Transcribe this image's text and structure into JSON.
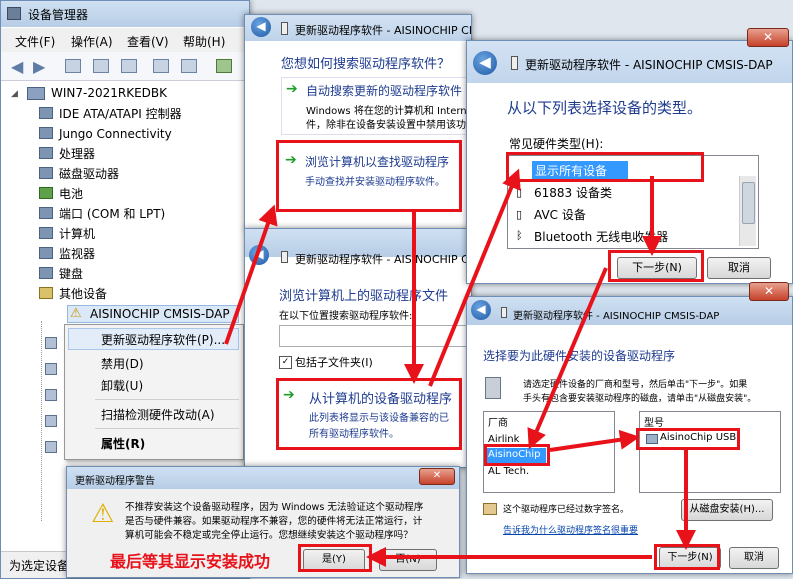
{
  "devmgr": {
    "title": "设备管理器",
    "menu": [
      "文件(F)",
      "操作(A)",
      "查看(V)",
      "帮助(H)"
    ],
    "computer": "WIN7-2021RKEDBK",
    "tree": [
      "IDE ATA/ATAPI 控制器",
      "Jungo Connectivity",
      "处理器",
      "磁盘驱动器",
      "电池",
      "端口 (COM 和 LPT)",
      "计算机",
      "监视器",
      "键盘",
      "其他设备"
    ],
    "device": "AISINOCHIP CMSIS-DAP",
    "status": "为选定设备"
  },
  "context_menu": {
    "items": [
      "更新驱动程序软件(P)...",
      "禁用(D)",
      "卸载(U)",
      "扫描检测硬件改动(A)",
      "属性(R)"
    ]
  },
  "dlg_search": {
    "title": "更新驱动程序软件 - AISINOCHIP CMSIS-DAP",
    "question": "您想如何搜索驱动程序软件？",
    "auto_title": "自动搜索更新的驱动程序软件",
    "auto_desc1": "Windows 将在您的计算机和 Internet",
    "auto_desc2": "件，除非在设备安装设置中禁用该功",
    "browse_title": "浏览计算机以查找驱动程序",
    "browse_desc": "手动查找并安装驱动程序软件。"
  },
  "dlg_browse": {
    "title": "更新驱动程序软件 - AISINOCHIP CMSIS-DAP",
    "heading": "浏览计算机上的驱动程序文件",
    "search_label": "在以下位置搜索驱动程序软件:",
    "subfolder": "包括子文件夹(I)",
    "pick_title": "从计算机的设备驱动程序",
    "pick_desc1": "此列表将显示与该设备兼容的已",
    "pick_desc2": "所有驱动程序软件。"
  },
  "dlg_type": {
    "title": "更新驱动程序软件 - AISINOCHIP CMSIS-DAP",
    "heading": "从以下列表选择设备的类型。",
    "list_label": "常见硬件类型(H):",
    "items": [
      "显示所有设备",
      "61883 设备类",
      "AVC 设备",
      "Bluetooth 无线电收发器"
    ],
    "next": "下一步(N)",
    "cancel": "取消"
  },
  "dlg_driver": {
    "title": "更新驱动程序软件 - AISINOCHIP CMSIS-DAP",
    "heading": "选择要为此硬件安装的设备驱动程序",
    "desc1": "请选定硬件设备的厂商和型号，然后单击\"下一步\"。如果",
    "desc2": "手头有包含要安装驱动程序的磁盘，请单击\"从磁盘安装\"。",
    "vendor_header": "厂商",
    "vendors": [
      "Airlink",
      "AisinoChip",
      "AL Tech."
    ],
    "model_header": "型号",
    "model": "AisinoChip USB",
    "signed": "这个驱动程序已经过数字签名。",
    "why_link": "告诉我为什么驱动程序签名很重要",
    "disk_button": "从磁盘安装(H)...",
    "next": "下一步(N)",
    "cancel": "取消"
  },
  "dlg_warn": {
    "title": "更新驱动程序警告",
    "line1": "不推荐安装这个设备驱动程序，因为 Windows 无法验证这个驱动程序",
    "line2": "是否与硬件兼容。如果驱动程序不兼容，您的硬件将无法正常运行，计",
    "line3": "算机可能会不稳定或完全停止运行。您想继续安装这个驱动程序吗？",
    "yes": "是(Y)",
    "no": "否(N)"
  },
  "annotation": "最后等其显示安装成功",
  "colors": {
    "accent": "#e8121a",
    "title_blue": "#1e3b8f",
    "select_blue": "#3399ff"
  }
}
